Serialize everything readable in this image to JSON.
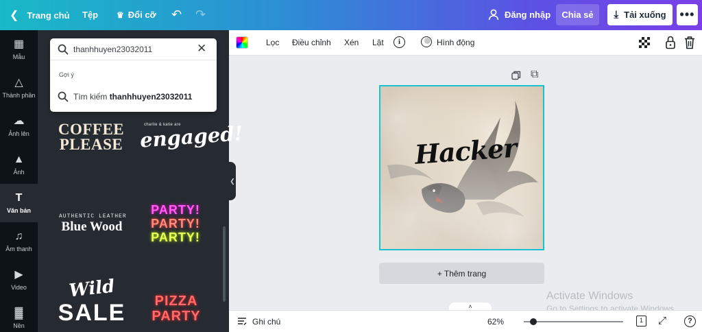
{
  "topbar": {
    "home_label": "Trang chủ",
    "file_label": "Tệp",
    "resize_label": "Đổi cỡ",
    "login_label": "Đăng nhập",
    "share_label": "Chia sẻ",
    "download_label": "Tải xuống",
    "more_glyph": "•••",
    "gradient_colors": [
      "#19b9c7",
      "#2c8fd4",
      "#5b52e3",
      "#7a3fe8"
    ]
  },
  "rail": {
    "items": [
      {
        "label": "Mẫu",
        "icon": "template-icon"
      },
      {
        "label": "Thành phần",
        "icon": "elements-icon"
      },
      {
        "label": "Ảnh lên",
        "icon": "upload-icon"
      },
      {
        "label": "Ảnh",
        "icon": "image-icon"
      },
      {
        "label": "Văn bản",
        "icon": "text-icon",
        "active": true
      },
      {
        "label": "Âm thanh",
        "icon": "music-icon"
      },
      {
        "label": "Video",
        "icon": "video-icon"
      },
      {
        "label": "Nền",
        "icon": "background-icon"
      }
    ]
  },
  "search": {
    "value": "thanhhuyen23032011",
    "suggest_heading": "Gợi ý",
    "suggest_prefix": "Tìm kiếm",
    "suggest_term": "thanhhuyen23032011"
  },
  "templates": {
    "coffee_line1": "COFFEE",
    "coffee_line2": "PLEASE",
    "engaged_small": "charlie & katie are",
    "engaged": "engaged!",
    "authentic": "AUTHENTIC LEATHER",
    "bluewood": "Blue Wood",
    "party": [
      "PARTY!",
      "PARTY!",
      "PARTY!"
    ],
    "wild": "Wild",
    "sale": "SALE",
    "pizza": [
      "PIZZA",
      "PARTY"
    ]
  },
  "editor_toolbar": {
    "filter": "Lọc",
    "adjust": "Điều chỉnh",
    "crop": "Xén",
    "flip": "Lật",
    "animate": "Hình động"
  },
  "canvas": {
    "design_text": "Hacker",
    "add_page": "+ Thêm trang",
    "selection_color": "#19c2d1"
  },
  "watermark": {
    "line1": "Activate Windows",
    "line2": "Go to Settings to activate Windows."
  },
  "bottombar": {
    "notes": "Ghi chú",
    "zoom": "62%",
    "zoom_fraction": 0.62,
    "page_count": "1"
  }
}
